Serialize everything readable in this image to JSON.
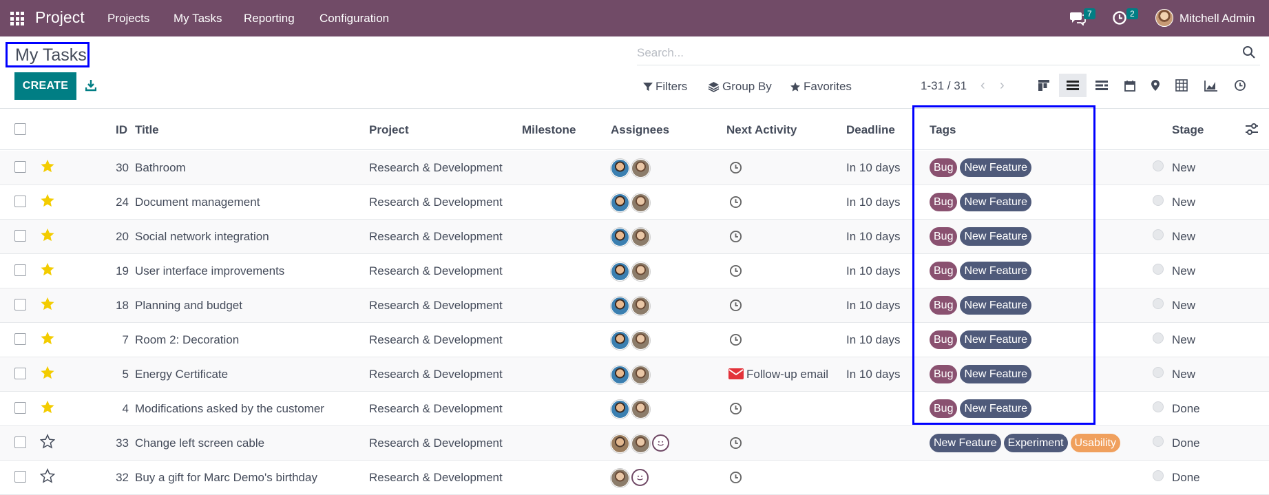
{
  "navbar": {
    "app_name": "Project",
    "menu": [
      "Projects",
      "My Tasks",
      "Reporting",
      "Configuration"
    ],
    "messages_count": "7",
    "activities_count": "2",
    "user_name": "Mitchell Admin"
  },
  "control_panel": {
    "page_title": "My Tasks",
    "search_placeholder": "Search...",
    "create_label": "CREATE",
    "filters_label": "Filters",
    "groupby_label": "Group By",
    "favorites_label": "Favorites",
    "pager": "1-31 / 31"
  },
  "table": {
    "headers": {
      "id": "ID",
      "title": "Title",
      "project": "Project",
      "milestone": "Milestone",
      "assignees": "Assignees",
      "next_activity": "Next Activity",
      "deadline": "Deadline",
      "tags": "Tags",
      "stage": "Stage"
    },
    "rows": [
      {
        "id": "30",
        "title": "Bathroom",
        "project": "Research & Development",
        "starred": true,
        "activity": "",
        "deadline": "In 10 days",
        "tags": [
          "Bug",
          "New Feature"
        ],
        "stage": "New"
      },
      {
        "id": "24",
        "title": "Document management",
        "project": "Research & Development",
        "starred": true,
        "activity": "",
        "deadline": "In 10 days",
        "tags": [
          "Bug",
          "New Feature"
        ],
        "stage": "New"
      },
      {
        "id": "20",
        "title": "Social network integration",
        "project": "Research & Development",
        "starred": true,
        "activity": "",
        "deadline": "In 10 days",
        "tags": [
          "Bug",
          "New Feature"
        ],
        "stage": "New"
      },
      {
        "id": "19",
        "title": "User interface improvements",
        "project": "Research & Development",
        "starred": true,
        "activity": "",
        "deadline": "In 10 days",
        "tags": [
          "Bug",
          "New Feature"
        ],
        "stage": "New"
      },
      {
        "id": "18",
        "title": "Planning and budget",
        "project": "Research & Development",
        "starred": true,
        "activity": "",
        "deadline": "In 10 days",
        "tags": [
          "Bug",
          "New Feature"
        ],
        "stage": "New"
      },
      {
        "id": "7",
        "title": "Room 2: Decoration",
        "project": "Research & Development",
        "starred": true,
        "activity": "",
        "deadline": "In 10 days",
        "tags": [
          "Bug",
          "New Feature"
        ],
        "stage": "New"
      },
      {
        "id": "5",
        "title": "Energy Certificate",
        "project": "Research & Development",
        "starred": true,
        "activity": "Follow-up email",
        "deadline": "In 10 days",
        "tags": [
          "Bug",
          "New Feature"
        ],
        "stage": "New"
      },
      {
        "id": "4",
        "title": "Modifications asked by the customer",
        "project": "Research & Development",
        "starred": true,
        "activity": "",
        "deadline": "",
        "tags": [
          "Bug",
          "New Feature"
        ],
        "stage": "Done"
      },
      {
        "id": "33",
        "title": "Change left screen cable",
        "project": "Research & Development",
        "starred": false,
        "activity": "",
        "deadline": "",
        "tags": [
          "New Feature",
          "Experiment",
          "Usability"
        ],
        "stage": "Done"
      },
      {
        "id": "32",
        "title": "Buy a gift for Marc Demo's birthday",
        "project": "Research & Development",
        "starred": false,
        "activity": "",
        "deadline": "",
        "tags": [],
        "stage": "Done"
      }
    ]
  },
  "colors": {
    "brand": "#714b67",
    "primary": "#017e84",
    "star": "#f3cc00",
    "tag_bug": "#8a5170",
    "tag_feature": "#4f5a7a",
    "tag_usability": "#f0a05d",
    "highlight": "#0000ff"
  }
}
